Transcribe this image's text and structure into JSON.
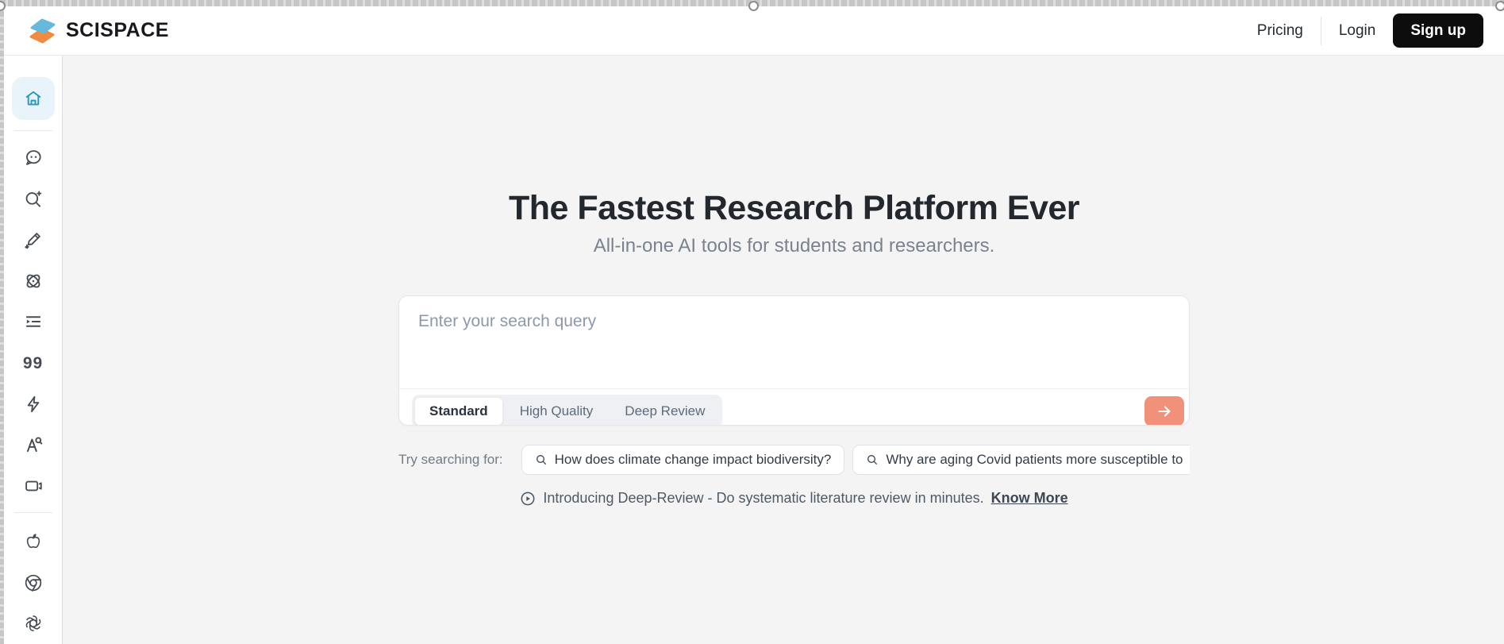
{
  "header": {
    "brand": "SCISPACE",
    "nav": {
      "pricing": "Pricing",
      "login": "Login",
      "signup": "Sign up"
    }
  },
  "sidebar": {
    "items": [
      {
        "icon": "home-icon",
        "active": true
      },
      {
        "icon": "chat-bot-icon"
      },
      {
        "icon": "search-sparkle-icon"
      },
      {
        "icon": "pencil-sparkle-icon"
      },
      {
        "icon": "atom-icon"
      },
      {
        "icon": "list-play-icon"
      },
      {
        "icon": "quotes-icon",
        "glyph": "99"
      },
      {
        "icon": "flash-icon"
      },
      {
        "icon": "text-search-icon"
      },
      {
        "icon": "video-icon"
      },
      {
        "icon": "apple-icon"
      },
      {
        "icon": "chrome-icon"
      },
      {
        "icon": "openai-icon"
      }
    ]
  },
  "hero": {
    "title": "The Fastest Research Platform Ever",
    "subtitle": "All-in-one AI tools for students and researchers."
  },
  "search": {
    "placeholder": "Enter your search query",
    "modes": [
      {
        "label": "Standard",
        "active": true
      },
      {
        "label": "High Quality",
        "active": false
      },
      {
        "label": "Deep Review",
        "active": false
      }
    ],
    "submit_icon": "arrow-right-icon"
  },
  "suggestions": {
    "label": "Try searching for:",
    "items": [
      {
        "query": "How does climate change impact biodiversity?"
      },
      {
        "query": "Why are aging Covid patients more susceptible to"
      }
    ]
  },
  "announcement": {
    "icon": "play-circle-icon",
    "text": "Introducing Deep-Review - Do systematic literature review in minutes.",
    "link": "Know More"
  },
  "colors": {
    "accent_orange": "#f2917a",
    "brand_blue": "#66b8dc",
    "brand_orange": "#ef8b43",
    "active_icon_blue": "#2e96c5",
    "main_bg": "#f4f4f5",
    "signup_bg": "#0d0d0d"
  }
}
